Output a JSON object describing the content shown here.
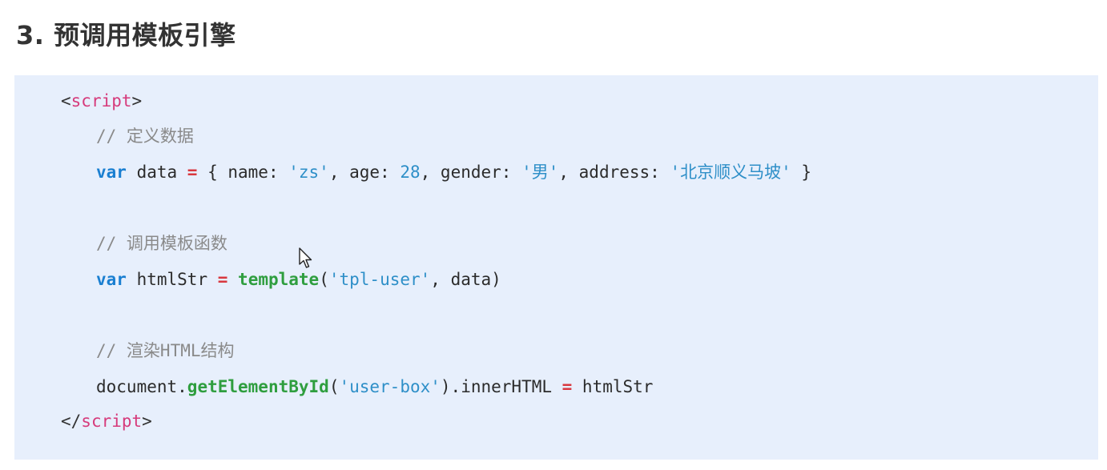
{
  "heading": "3. 预调用模板引擎",
  "code": {
    "line1": {
      "open": "<",
      "name": "script",
      "close": ">"
    },
    "line2": {
      "comment": "// 定义数据"
    },
    "line3": {
      "kw": "var",
      "t1": " data ",
      "op": "=",
      "t2": " { name: ",
      "s1": "'zs'",
      "t3": ", age: ",
      "n1": "28",
      "t4": ", gender: ",
      "s2": "'男'",
      "t5": ", address: ",
      "s3": "'北京顺义马坡'",
      "t6": " }"
    },
    "line4": {
      "comment": "// 调用模板函数"
    },
    "line5": {
      "kw": "var",
      "t1": " htmlStr ",
      "op": "=",
      "sp": " ",
      "fn": "template",
      "t2": "(",
      "s1": "'tpl-user'",
      "t3": ", data)"
    },
    "line6": {
      "comment": "// 渲染HTML结构"
    },
    "line7": {
      "t1": "document.",
      "fn": "getElementById",
      "t2": "(",
      "s1": "'user-box'",
      "t3": ").innerHTML ",
      "op": "=",
      "t4": " htmlStr"
    },
    "line8": {
      "open": "</",
      "name": "script",
      "close": ">"
    }
  },
  "icons": {
    "cursor": "mouse-pointer-icon"
  }
}
